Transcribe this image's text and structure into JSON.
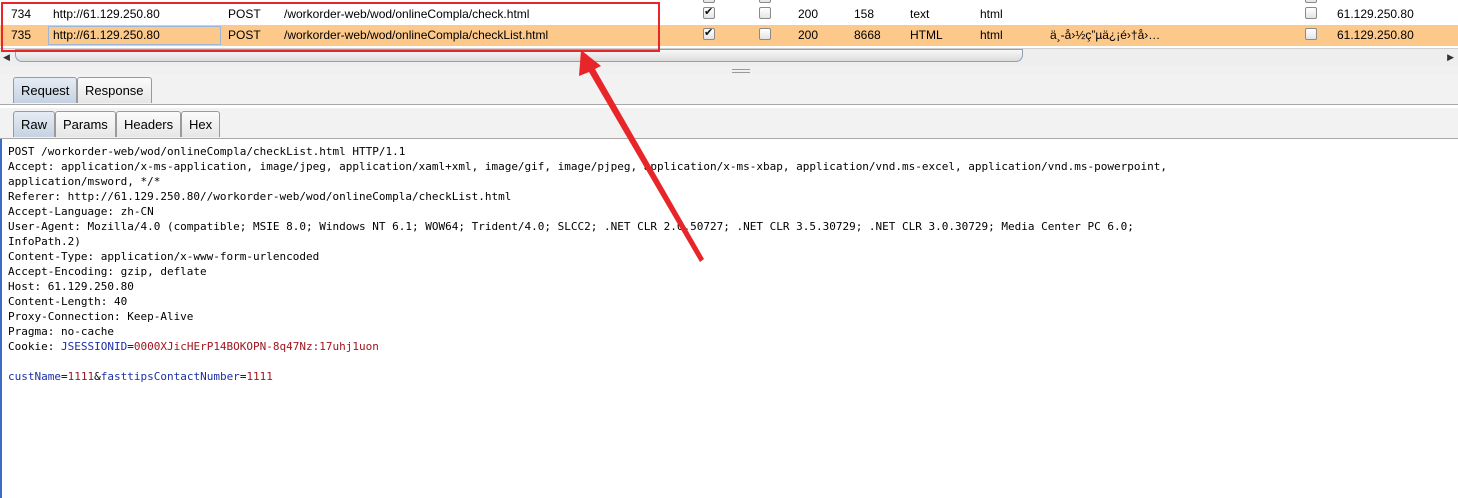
{
  "history": {
    "rows": [
      {
        "num": "734",
        "host": "http://61.129.250.80",
        "method": "POST",
        "url": "/workorder-web/wod/onlineCompla/check.html",
        "params_checked": true,
        "edited_checked": false,
        "status": "200",
        "length": "158",
        "mime": "text",
        "ext": "html",
        "title": "",
        "ssl_checked": false,
        "ip": "61.129.250.80",
        "selected": false
      },
      {
        "num": "735",
        "host": "http://61.129.250.80",
        "method": "POST",
        "url": "/workorder-web/wod/onlineCompla/checkList.html",
        "params_checked": true,
        "edited_checked": false,
        "status": "200",
        "length": "8668",
        "mime": "HTML",
        "ext": "html",
        "title": "ä¸-å›½ç”µä¿¡é›†å›…",
        "ssl_checked": false,
        "ip": "61.129.250.80",
        "selected": true
      }
    ]
  },
  "tabs_main": [
    "Request",
    "Response"
  ],
  "tabs_sub": [
    "Raw",
    "Params",
    "Headers",
    "Hex"
  ],
  "request": {
    "lines": [
      "POST /workorder-web/wod/onlineCompla/checkList.html HTTP/1.1",
      "Accept: application/x-ms-application, image/jpeg, application/xaml+xml, image/gif, image/pjpeg, application/x-ms-xbap, application/vnd.ms-excel, application/vnd.ms-powerpoint,",
      "application/msword, */*",
      "Referer: http://61.129.250.80//workorder-web/wod/onlineCompla/checkList.html",
      "Accept-Language: zh-CN",
      "User-Agent: Mozilla/4.0 (compatible; MSIE 8.0; Windows NT 6.1; WOW64; Trident/4.0; SLCC2; .NET CLR 2.0.50727; .NET CLR 3.5.30729; .NET CLR 3.0.30729; Media Center PC 6.0;",
      "InfoPath.2)",
      "Content-Type: application/x-www-form-urlencoded",
      "Accept-Encoding: gzip, deflate",
      "Host: 61.129.250.80",
      "Content-Length: 40",
      "Proxy-Connection: Keep-Alive",
      "Pragma: no-cache"
    ],
    "cookie_label": "Cookie: ",
    "cookie_name": "JSESSIONID",
    "cookie_eq": "=",
    "cookie_value": "0000XJicHErP14BOKOPN-8q47Nz:17uhj1uon",
    "body": {
      "param1_name": "custName",
      "eq1": "=",
      "param1_value": "1111",
      "amp": "&",
      "param2_name": "fasttipsContactNumber",
      "eq2": "=",
      "param2_value": "1111"
    }
  },
  "colors": {
    "selected_row": "#fcc98b",
    "annotation": "#e8262a",
    "param_name": "#1b2fa8",
    "param_value": "#a01520"
  }
}
